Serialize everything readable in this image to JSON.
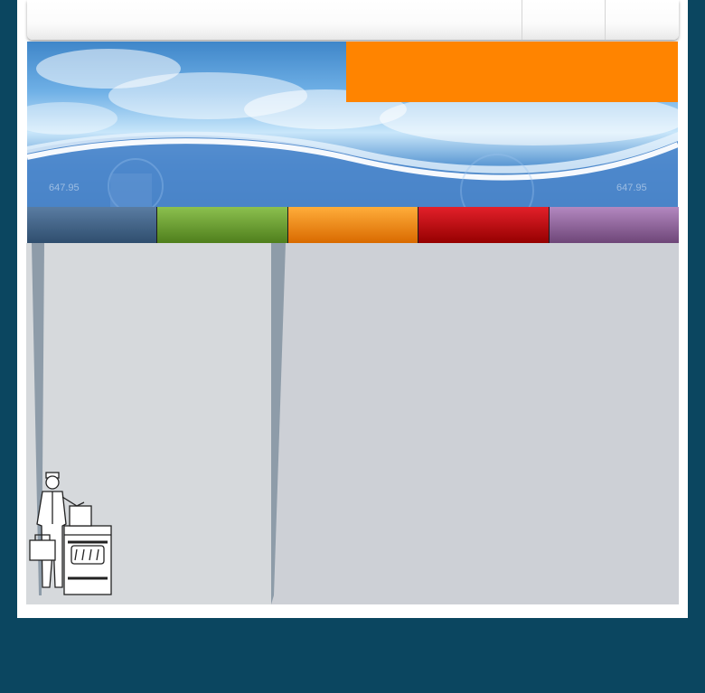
{
  "colors": {
    "background": "#0b4660",
    "page": "#ffffff",
    "promo": "#ff8400"
  },
  "header": {
    "ticker_left": "647.95",
    "ticker_right": "647.95"
  },
  "nav": {
    "tabs": [
      {
        "color_top": "#5a7ca2",
        "color_bottom": "#2f4e6e"
      },
      {
        "color_top": "#8cc04f",
        "color_bottom": "#4f7f1c"
      },
      {
        "color_top": "#ffad3a",
        "color_bottom": "#d96a00"
      },
      {
        "color_top": "#e3202a",
        "color_bottom": "#950000"
      },
      {
        "color_top": "#b388c0",
        "color_bottom": "#6e4678"
      }
    ]
  },
  "illustration": {
    "icon": "appliance-repairman-icon"
  }
}
